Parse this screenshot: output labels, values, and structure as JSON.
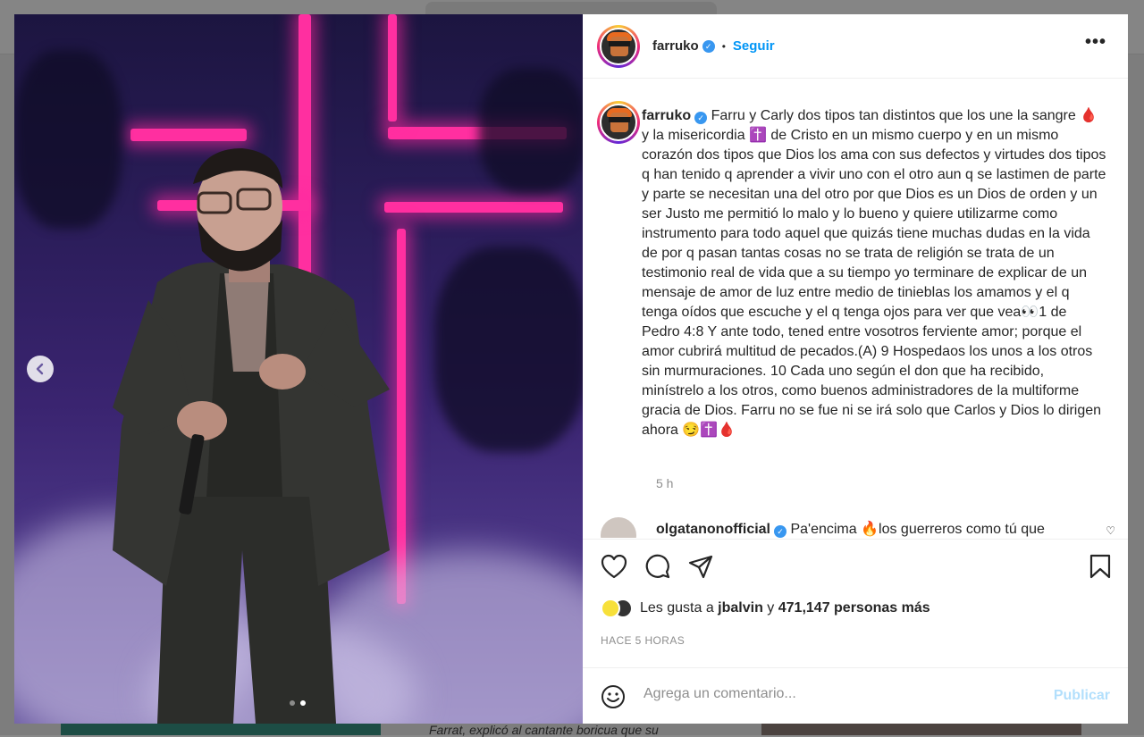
{
  "background": {
    "snippet": "Farrat, explicó al cantante boricua que su"
  },
  "post": {
    "username": "farruko",
    "follow_label": "Seguir",
    "separator": "•",
    "more_label": "•••",
    "carousel": {
      "total": 2,
      "active": 2
    }
  },
  "caption": {
    "username": "farruko",
    "text": " Farru y Carly dos tipos tan distintos que los une la sangre 🩸 y la misericordia ✝️ de Cristo en un mismo cuerpo y en un mismo corazón dos tipos que Dios los ama con sus defectos y virtudes dos tipos q han tenido q aprender a vivir uno con el otro aun q se lastimen de parte y parte se necesitan una del otro por que Dios es un Dios de orden y un ser Justo me permitió lo malo y lo bueno y quiere utilizarme como instrumento para todo aquel que quizás tiene muchas dudas en la vida de por q pasan tantas cosas no se trata de religión se trata de un testimonio real de vida que a su tiempo yo terminare de explicar de un mensaje de amor de luz entre medio de tinieblas los amamos y el q tenga oídos que escuche y el q tenga ojos para ver que vea👀1 de Pedro 4:8 Y ante todo, tened entre vosotros ferviente amor; porque el amor cubrirá multitud de pecados.(A) 9 Hospedaos los unos a los otros sin murmuraciones. 10 Cada uno según el don que ha recibido, minístrelo a los otros, como buenos administradores de la multiforme gracia de Dios. Farru no se fue ni se irá solo que Carlos y Dios lo dirigen ahora 😏✝️🩸",
    "time": "5 h"
  },
  "comment": {
    "username": "olgatanonofficial",
    "text": " Pa'encima 🔥los guerreros como tú que"
  },
  "likes": {
    "prefix": "Les gusta a ",
    "user": "jbalvin",
    "middle": " y ",
    "count": "471,147 personas más"
  },
  "timestamp": "HACE 5 HORAS",
  "comment_box": {
    "placeholder": "Agrega un comentario...",
    "publish_label": "Publicar"
  }
}
